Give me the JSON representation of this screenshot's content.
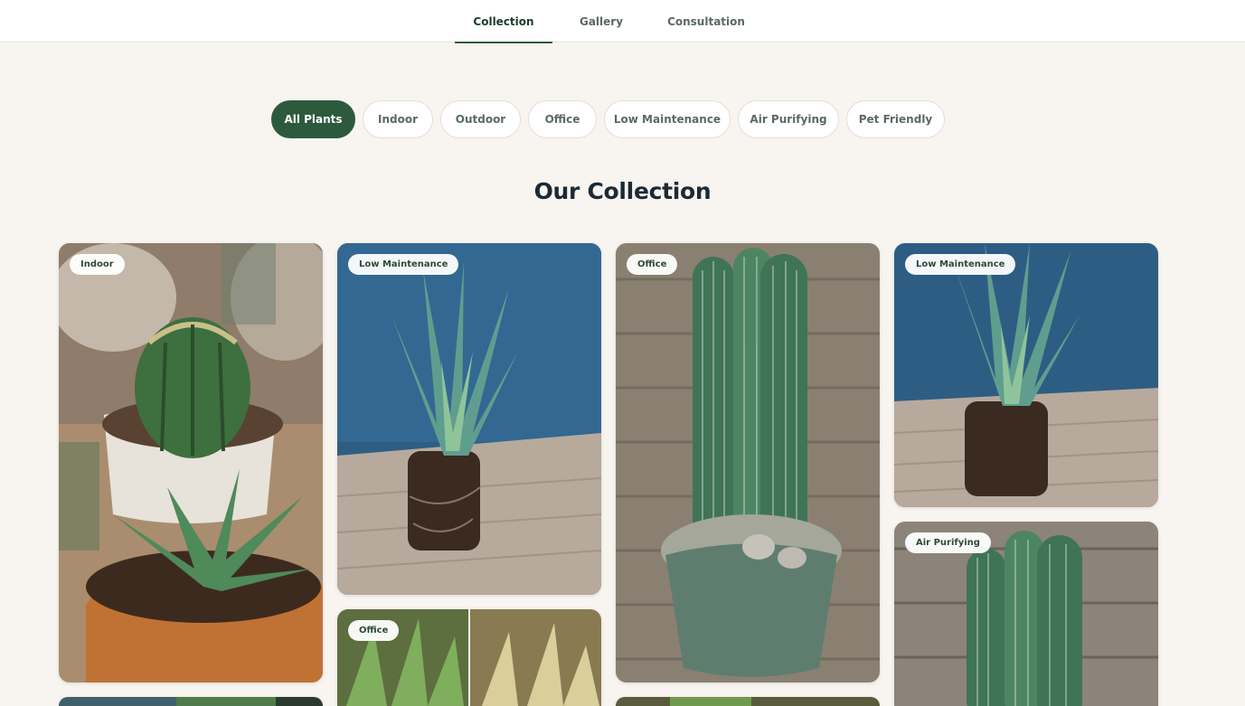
{
  "nav": {
    "tabs": [
      {
        "label": "Collection",
        "active": true
      },
      {
        "label": "Gallery",
        "active": false
      },
      {
        "label": "Consultation",
        "active": false
      }
    ]
  },
  "filters": [
    {
      "label": "All Plants",
      "active": true
    },
    {
      "label": "Indoor",
      "active": false
    },
    {
      "label": "Outdoor",
      "active": false
    },
    {
      "label": "Office",
      "active": false
    },
    {
      "label": "Low Maintenance",
      "active": false
    },
    {
      "label": "Air Purifying",
      "active": false
    },
    {
      "label": "Pet Friendly",
      "active": false
    }
  ],
  "collection": {
    "title": "Our Collection",
    "cards": [
      {
        "tag": "Indoor",
        "image": "cactus-and-succulents-in-pots"
      },
      {
        "tag": "Low Maintenance",
        "image": "aloe-with-bare-roots"
      },
      {
        "tag": "Office",
        "image": "columnar-cacti-in-green-pot"
      },
      {
        "tag": "Low Maintenance",
        "image": "aloe-with-bare-roots"
      },
      {
        "tag": "Air Purifying",
        "image": "columnar-cacti"
      },
      {
        "tag": "Office",
        "image": "succulent-collage"
      },
      {
        "tag": "",
        "image": "plant-photo"
      },
      {
        "tag": "",
        "image": "plant-photo"
      }
    ]
  },
  "colors": {
    "accent": "#2d5a3c",
    "background": "#f8f5f0"
  }
}
